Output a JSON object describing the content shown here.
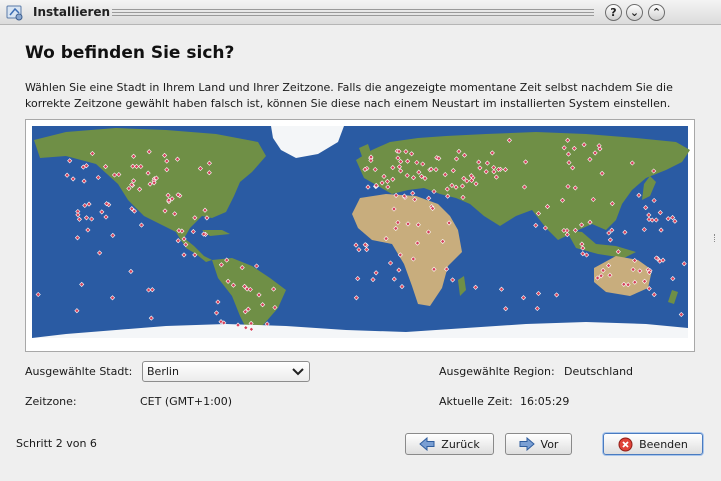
{
  "window": {
    "title": "Installieren"
  },
  "window_buttons": {
    "help": "?",
    "minimize": "⌄",
    "maximize": "⌃"
  },
  "page": {
    "heading": "Wo befinden Sie sich?",
    "description": "Wählen Sie eine Stadt in Ihrem Land und Ihrer Zeitzone. Falls die angezeigte momentane Zeit selbst nachdem Sie die korrekte Zeitzone gewählt haben falsch ist, können Sie diese nach einem Neustart im installierten System einstellen."
  },
  "location": {
    "city_label": "Ausgewählte Stadt:",
    "city_value": "Berlin",
    "region_label": "Ausgewählte Region:",
    "region_value": "Deutschland",
    "timezone_label": "Zeitzone:",
    "timezone_value": "CET (GMT+1:00)",
    "time_label": "Aktuelle Zeit:",
    "time_value": "16:05:29"
  },
  "footer": {
    "step": "Schritt 2 von 6",
    "back_label": "Zurück",
    "next_label": "Vor",
    "quit_label": "Beenden"
  },
  "colors": {
    "ocean": "#2a5ba3",
    "land": "#6f8f46",
    "desert": "#c8ad7d",
    "ice": "#f4f6f8",
    "marker": "#d4405a"
  }
}
